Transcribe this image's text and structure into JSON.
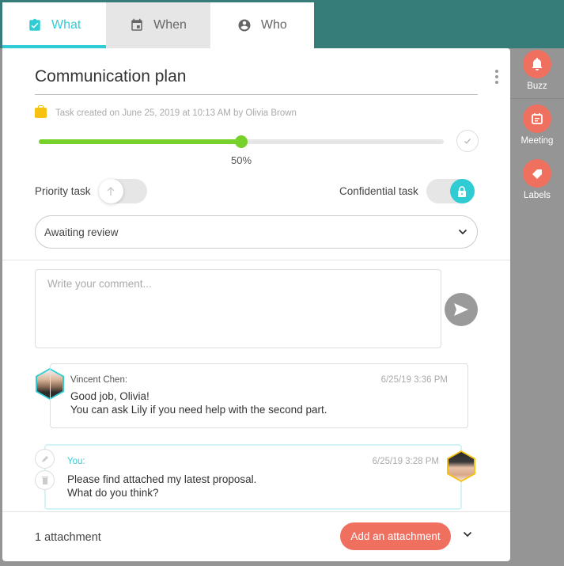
{
  "tabs": [
    {
      "label": "What",
      "icon": "clipboard-check-icon",
      "active": true
    },
    {
      "label": "When",
      "icon": "calendar-icon",
      "active": false
    },
    {
      "label": "Who",
      "icon": "user-circle-icon",
      "active": false
    }
  ],
  "task": {
    "title": "Communication plan",
    "meta": "Task created on June 25, 2019 at 10:13 AM by Olivia Brown",
    "progress_percent": 50,
    "progress_label": "50%",
    "priority_label": "Priority task",
    "priority_on": false,
    "confidential_label": "Confidential task",
    "confidential_on": true,
    "status": "Awaiting review"
  },
  "comment": {
    "placeholder": "Write your comment..."
  },
  "messages": [
    {
      "author": "Vincent Chen:",
      "time": "6/25/19 3:36 PM",
      "lines": [
        "Good job, Olivia!",
        "You can ask Lily if you need help with the second part."
      ]
    },
    {
      "author": "You:",
      "time": "6/25/19 3:28 PM",
      "lines": [
        "Please find attached my latest proposal.",
        "What do you think?"
      ]
    }
  ],
  "footer": {
    "attachments": "1 attachment",
    "add_label": "Add an attachment"
  },
  "sidebar": [
    {
      "label": "Buzz",
      "icon": "bell-icon"
    },
    {
      "label": "Meeting",
      "icon": "calendar-note-icon"
    },
    {
      "label": "Labels",
      "icon": "tag-icon"
    }
  ],
  "colors": {
    "accent": "#2fcdd3",
    "progress": "#76d12a",
    "action": "#f07060",
    "header": "#367c78"
  }
}
